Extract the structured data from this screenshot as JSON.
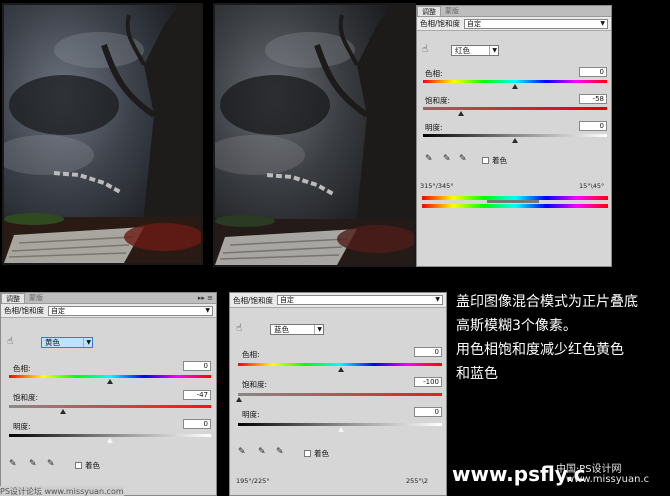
{
  "panel1": {
    "tabs": [
      "调整",
      "蒙版"
    ],
    "header_title": "色相/饱和度",
    "preset": "自定",
    "channel": "红色",
    "hue_label": "色相:",
    "hue_value": "0",
    "sat_label": "饱和度:",
    "sat_value": "-58",
    "light_label": "明度:",
    "light_value": "0",
    "colorize_label": "着色",
    "range_left": "315°/345°",
    "range_right": "15°\\45°"
  },
  "panel2": {
    "tabs": [
      "调整",
      "蒙版"
    ],
    "header_title": "色相/饱和度",
    "preset": "自定",
    "channel": "黄色",
    "hue_label": "色相:",
    "hue_value": "0",
    "sat_label": "饱和度:",
    "sat_value": "-47",
    "light_label": "明度:",
    "light_value": "0",
    "colorize_label": "着色"
  },
  "panel3": {
    "header_title": "色相/饱和度",
    "preset": "自定",
    "channel": "蓝色",
    "hue_label": "色相:",
    "hue_value": "0",
    "sat_label": "饱和度:",
    "sat_value": "-100",
    "light_label": "明度:",
    "light_value": "0",
    "colorize_label": "着色",
    "range_left": "195°/225°",
    "range_right": "255°\\2"
  },
  "caption": {
    "lines": [
      "盖印图像混合模式为正片叠底",
      "高斯模糊3个像素。",
      "用色相饱和度减少红色黄色",
      "和蓝色"
    ]
  },
  "watermarks": {
    "psfly": "www.psfly.c",
    "missyuan_cn": "中国·PS设计网",
    "missyuan_url": "www.missyuan.c",
    "left_partial": "PS设计论坛  www.missyuan.com"
  },
  "colors": {
    "panel_bg": "#d6d6d6",
    "highlight": "#bfe0ff",
    "caption": "#ffffff"
  }
}
